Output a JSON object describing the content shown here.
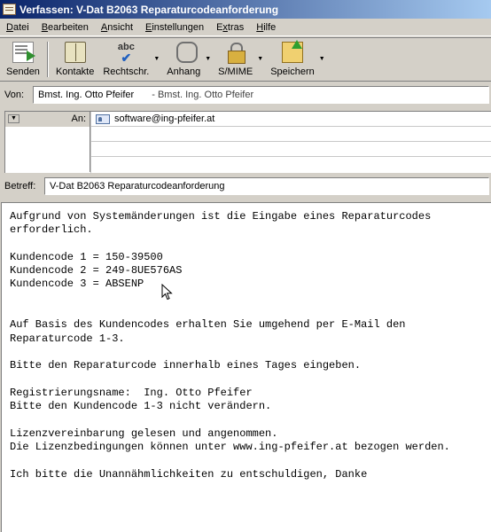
{
  "window": {
    "title": "Verfassen: V-Dat B2063 Reparaturcodeanforderung"
  },
  "menu": [
    {
      "label": "Datei",
      "accel": "D"
    },
    {
      "label": "Bearbeiten",
      "accel": "B"
    },
    {
      "label": "Ansicht",
      "accel": "A"
    },
    {
      "label": "Einstellungen",
      "accel": "E"
    },
    {
      "label": "Extras",
      "accel": "x"
    },
    {
      "label": "Hilfe",
      "accel": "H"
    }
  ],
  "toolbar": {
    "send": "Senden",
    "contacts": "Kontakte",
    "spell": "Rechtschr.",
    "spell_icon_text": "abc",
    "attach": "Anhang",
    "smime": "S/MIME",
    "save": "Speichern"
  },
  "from": {
    "label": "Von:",
    "name": "Bmst. Ing. Otto Pfeifer",
    "secondary": "- Bmst. Ing. Otto Pfeifer"
  },
  "recipients": [
    {
      "type": "An:",
      "address": "software@ing-pfeifer.at"
    }
  ],
  "subject": {
    "label": "Betreff:",
    "value": "V-Dat B2063 Reparaturcodeanforderung"
  },
  "body": {
    "lines": [
      "Aufgrund von Systemänderungen ist die Eingabe eines Reparaturcodes",
      "erforderlich.",
      "",
      "Kundencode 1 = 150-39500",
      "Kundencode 2 = 249-8UE576AS",
      "Kundencode 3 = ABSENP",
      "",
      "",
      "Auf Basis des Kundencodes erhalten Sie umgehend per E-Mail den",
      "Reparaturcode 1-3.",
      "",
      "Bitte den Reparaturcode innerhalb eines Tages eingeben.",
      "",
      "Registrierungsname:  Ing. Otto Pfeifer",
      "Bitte den Kundencode 1-3 nicht verändern.",
      "",
      "Lizenzvereinbarung gelesen und angenommen.",
      "Die Lizenzbedingungen können unter www.ing-pfeifer.at bezogen werden.",
      "",
      "Ich bitte die Unannähmlichkeiten zu entschuldigen, Danke"
    ]
  },
  "icons": {
    "app": "compose-icon",
    "send": "send-icon",
    "contacts": "address-book-icon",
    "spell": "spellcheck-icon",
    "attach": "paperclip-icon",
    "smime": "lock-icon",
    "save": "save-icon",
    "contact": "contact-card-icon",
    "cursor": "mouse-pointer-icon"
  },
  "colors": {
    "titlebar_start": "#0a246a",
    "titlebar_end": "#a6caf0",
    "chrome": "#d4d0c8"
  }
}
